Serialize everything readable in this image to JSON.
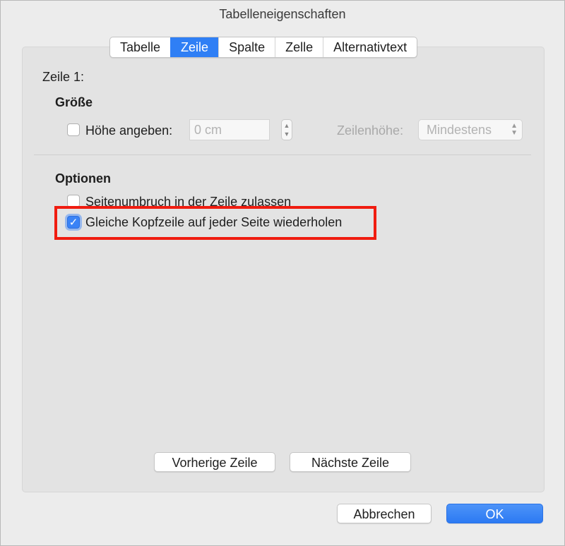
{
  "window": {
    "title": "Tabelleneigenschaften"
  },
  "tabs": [
    {
      "label": "Tabelle",
      "active": false
    },
    {
      "label": "Zeile",
      "active": true
    },
    {
      "label": "Spalte",
      "active": false
    },
    {
      "label": "Zelle",
      "active": false
    },
    {
      "label": "Alternativtext",
      "active": false
    }
  ],
  "row_heading": "Zeile 1:",
  "size_section": {
    "heading": "Größe",
    "height_checkbox": {
      "label": "Höhe angeben:",
      "checked": false
    },
    "height_field": {
      "value": "",
      "placeholder": "0 cm"
    },
    "row_height_label": "Zeilenhöhe:",
    "row_height_select": {
      "value": "Mindestens"
    }
  },
  "options_section": {
    "heading": "Optionen",
    "allow_break": {
      "label": "Seitenumbruch in der Zeile zulassen",
      "checked": false
    },
    "repeat_header": {
      "label": "Gleiche Kopfzeile auf jeder Seite wiederholen",
      "checked": true
    }
  },
  "nav_buttons": {
    "previous": "Vorherige Zeile",
    "next": "Nächste Zeile"
  },
  "footer_buttons": {
    "cancel": "Abbrechen",
    "ok": "OK"
  },
  "icons": {
    "checkmark": "checkmark-icon",
    "stepper": "stepper-arrows-icon",
    "chevron": "up-down-chevron-icon"
  },
  "colors": {
    "accent": "#2f7ff5",
    "highlight": "#f01c10"
  }
}
